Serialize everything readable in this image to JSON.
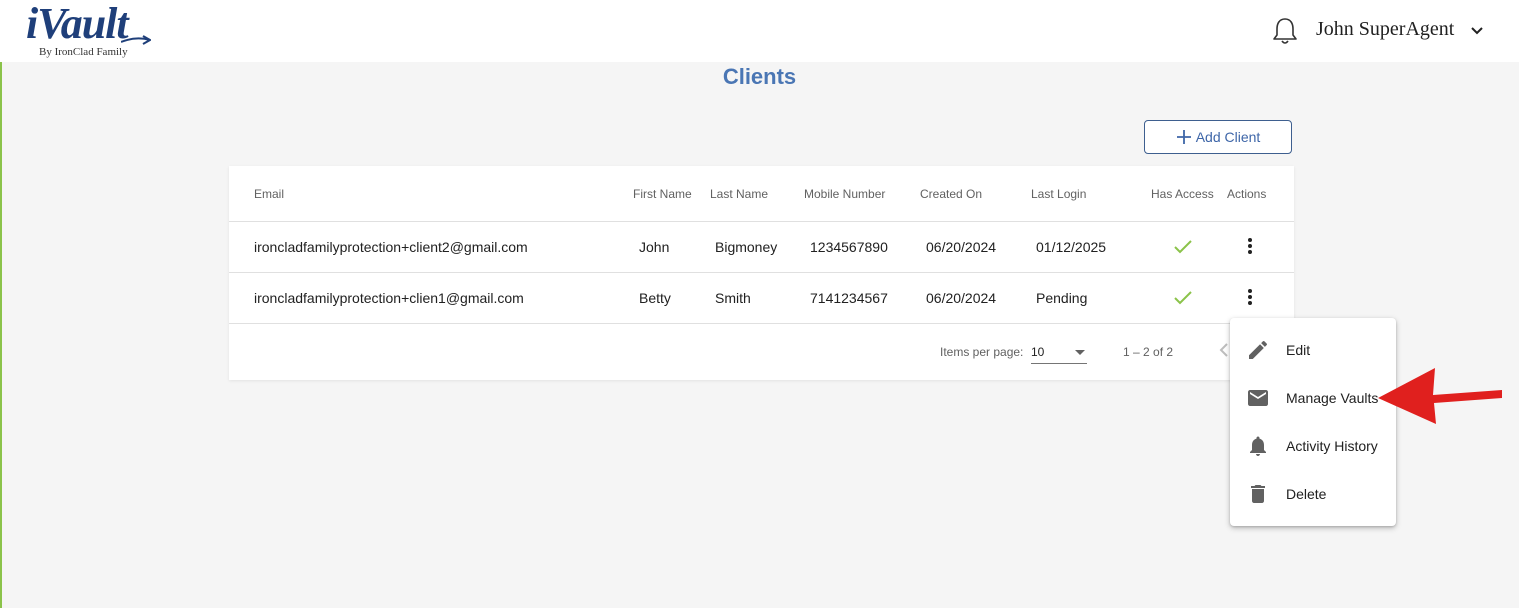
{
  "header": {
    "logo_text": "iVault",
    "logo_subtitle": "By IronClad Family",
    "user_name": "John SuperAgent",
    "icons": {
      "notifications": "bell-icon",
      "user_menu": "chevron-down-icon"
    }
  },
  "page": {
    "title": "Clients",
    "add_button_label": "Add Client",
    "add_button_icon": "plus-icon"
  },
  "table": {
    "headers": [
      "Email",
      "First Name",
      "Last Name",
      "Mobile Number",
      "Created On",
      "Last Login",
      "Has Access",
      "Actions"
    ],
    "rows": [
      {
        "email": "ironcladfamilyprotection+client2@gmail.com",
        "first_name": "John",
        "last_name": "Bigmoney",
        "mobile": "1234567890",
        "created_on": "06/20/2024",
        "last_login": "01/12/2025",
        "has_access": true
      },
      {
        "email": "ironcladfamilyprotection+clien1@gmail.com",
        "first_name": "Betty",
        "last_name": "Smith",
        "mobile": "7141234567",
        "created_on": "06/20/2024",
        "last_login": "Pending",
        "has_access": true
      }
    ],
    "paginator": {
      "items_per_page_label": "Items per page:",
      "items_per_page": "10",
      "range_label": "1 – 2 of 2"
    }
  },
  "actions_menu": {
    "items": [
      {
        "label": "Edit",
        "icon": "pencil-icon"
      },
      {
        "label": "Manage Vaults",
        "icon": "mail-icon"
      },
      {
        "label": "Activity History",
        "icon": "bell-icon"
      },
      {
        "label": "Delete",
        "icon": "trash-icon"
      }
    ]
  },
  "colors": {
    "brand": "#1f3f7a",
    "title": "#4a76b4",
    "check": "#8bc34a",
    "arrow": "#e0201e"
  }
}
